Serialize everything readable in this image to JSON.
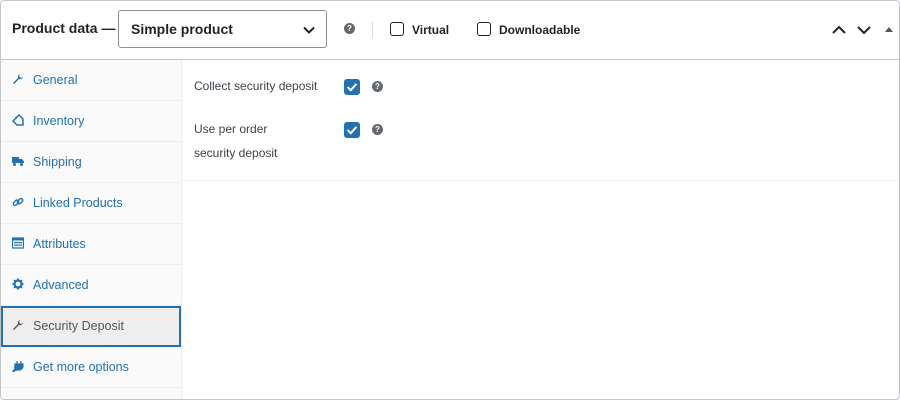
{
  "header": {
    "title": "Product data —",
    "product_type": "Simple product",
    "virtual_label": "Virtual",
    "downloadable_label": "Downloadable",
    "virtual_checked": false,
    "downloadable_checked": false
  },
  "tabs": [
    {
      "label": "General",
      "icon": "wrench-icon",
      "active": false
    },
    {
      "label": "Inventory",
      "icon": "tag-icon",
      "active": false
    },
    {
      "label": "Shipping",
      "icon": "truck-icon",
      "active": false
    },
    {
      "label": "Linked Products",
      "icon": "link-icon",
      "active": false
    },
    {
      "label": "Attributes",
      "icon": "list-icon",
      "active": false
    },
    {
      "label": "Advanced",
      "icon": "gear-icon",
      "active": false
    },
    {
      "label": "Security Deposit",
      "icon": "wrench-icon",
      "active": true
    },
    {
      "label": "Get more options",
      "icon": "plugin-icon",
      "active": false
    }
  ],
  "fields": [
    {
      "label": "Collect security deposit",
      "checked": true
    },
    {
      "label_line1": "Use per order",
      "label_line2": "security deposit",
      "checked": true
    }
  ],
  "colors": {
    "accent": "#2271b1",
    "active_tab_bg": "#eeeeee",
    "text": "#1d2327"
  }
}
